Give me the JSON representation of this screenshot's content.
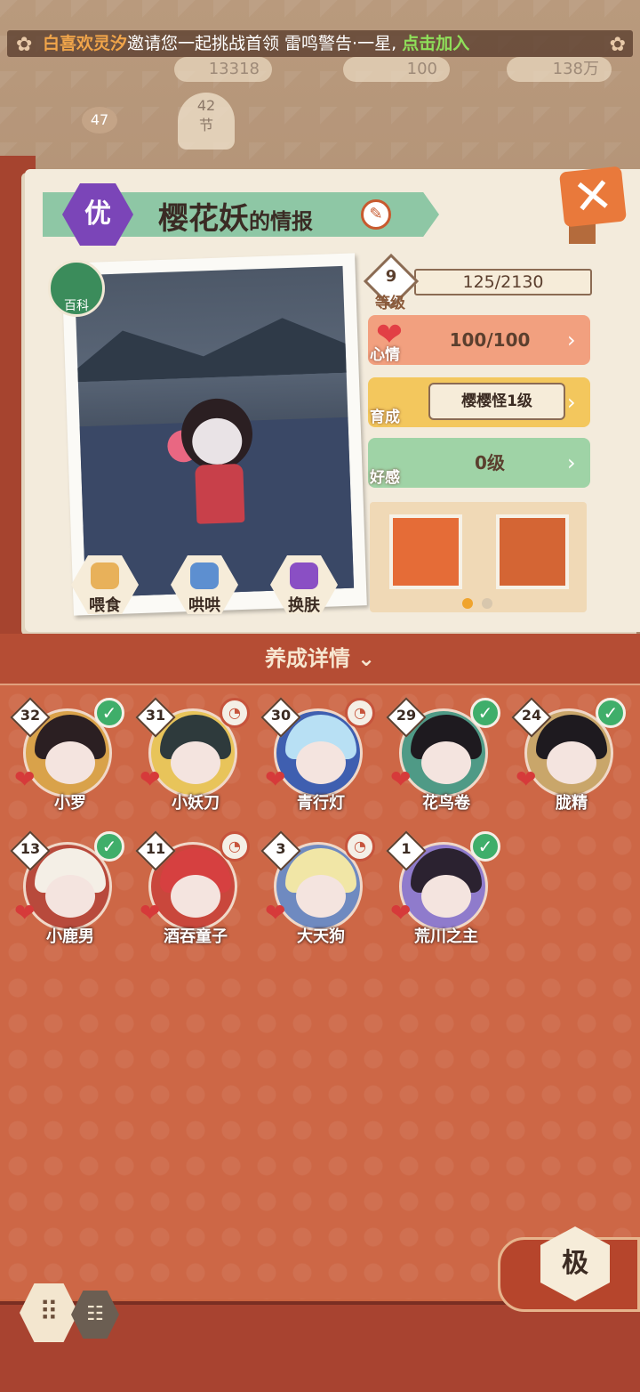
{
  "marquee": {
    "player": "白喜欢灵汐",
    "message": "邀请您一起挑战首领 雷鸣警告·一星,",
    "join": "点击加入"
  },
  "top": {
    "res1": "13318",
    "res2": "100",
    "res3": "138万",
    "level": "47",
    "fan_number": "42",
    "fan_label": "节"
  },
  "header": {
    "grade": "优",
    "name": "樱花妖",
    "suffix": "的情报"
  },
  "pedia_label": "百科",
  "actions": [
    {
      "label": "喂食",
      "color": "#e8b15a"
    },
    {
      "label": "哄哄",
      "color": "#5d8fd0"
    },
    {
      "label": "换肤",
      "color": "#8a4fc4"
    }
  ],
  "stats": {
    "level_label": "等级",
    "level_value": "9",
    "exp": "125/2130",
    "mood_label": "心情",
    "mood_value": "100/100",
    "train_label": "育成",
    "train_value": "樱樱怪1级",
    "favor_label": "好感",
    "favor_value": "0级"
  },
  "detail": {
    "title": "养成详情",
    "chevron": "»"
  },
  "characters": [
    {
      "name": "小罗",
      "level": "32",
      "status": "check",
      "hair": "#2b1f22",
      "bg": "#d9a24a"
    },
    {
      "name": "小妖刀",
      "level": "31",
      "status": "hint",
      "hair": "#2e3a3c",
      "bg": "#e8c45a"
    },
    {
      "name": "青行灯",
      "level": "30",
      "status": "hint",
      "hair": "#b8e0f4",
      "bg": "#3f5fb0"
    },
    {
      "name": "花鸟卷",
      "level": "29",
      "status": "check",
      "hair": "#1e1a1f",
      "bg": "#4f9a86"
    },
    {
      "name": "胧精",
      "level": "24",
      "status": "check",
      "hair": "#1e1a1f",
      "bg": "#c9a66a"
    },
    {
      "name": "小鹿男",
      "level": "13",
      "status": "check",
      "hair": "#f4efe6",
      "bg": "#b84a3c"
    },
    {
      "name": "酒吞童子",
      "level": "11",
      "status": "hint",
      "hair": "#d64040",
      "bg": "#c9473c"
    },
    {
      "name": "大天狗",
      "level": "3",
      "status": "hint",
      "hair": "#f1e6a6",
      "bg": "#6f8ac0"
    },
    {
      "name": "荒川之主",
      "level": "1",
      "status": "check",
      "hair": "#2b2230",
      "bg": "#8f7bcc"
    }
  ],
  "check_mark": "✓",
  "hint_mark": "◔",
  "heart_mark": "❤",
  "rank_label": "极",
  "grid_icon": "⠿",
  "list_icon": "☷",
  "close_icon": "✕",
  "edit_icon": "✎"
}
